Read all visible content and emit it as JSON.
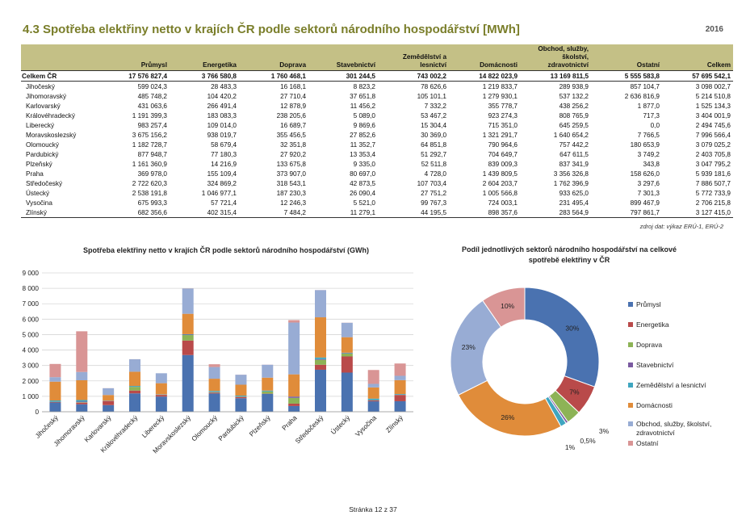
{
  "header": {
    "title": "4.3  Spotřeba elektřiny netto v krajích ČR podle sektorů národního hospodářství [MWh]",
    "year": "2016"
  },
  "table": {
    "columns": [
      "",
      "Průmysl",
      "Energetika",
      "Doprava",
      "Stavebnictví",
      "Zemědělství a lesnictví",
      "Domácnosti",
      "Obchod, služby, školství, zdravotnictví",
      "Ostatní",
      "Celkem"
    ],
    "total": [
      "Celkem ČR",
      "17 576 827,4",
      "3 766 580,8",
      "1 760 468,1",
      "301 244,5",
      "743 002,2",
      "14 822 023,9",
      "13 169 811,5",
      "5 555 583,8",
      "57 695 542,1"
    ],
    "rows": [
      [
        "Jihočeský",
        "599 024,3",
        "28 483,3",
        "16 168,1",
        "8 823,2",
        "78 626,6",
        "1 219 833,7",
        "289 938,9",
        "857 104,7",
        "3 098 002,7"
      ],
      [
        "Jihomoravský",
        "485 748,2",
        "104 420,2",
        "27 710,4",
        "37 651,8",
        "105 101,1",
        "1 279 930,1",
        "537 132,2",
        "2 636 816,9",
        "5 214 510,8"
      ],
      [
        "Karlovarský",
        "431 063,6",
        "266 491,4",
        "12 878,9",
        "11 456,2",
        "7 332,2",
        "355 778,7",
        "438 256,2",
        "1 877,0",
        "1 525 134,3"
      ],
      [
        "Královéhradecký",
        "1 191 399,3",
        "183 083,3",
        "238 205,6",
        "5 089,0",
        "53 467,2",
        "923 274,3",
        "808 765,9",
        "717,3",
        "3 404 001,9"
      ],
      [
        "Liberecký",
        "983 257,4",
        "109 014,0",
        "16 689,7",
        "9 869,6",
        "15 304,4",
        "715 351,0",
        "645 259,5",
        "0,0",
        "2 494 745,6"
      ],
      [
        "Moravskoslezský",
        "3 675 156,2",
        "938 019,7",
        "355 456,5",
        "27 852,6",
        "30 369,0",
        "1 321 291,7",
        "1 640 654,2",
        "7 766,5",
        "7 996 566,4"
      ],
      [
        "Olomoucký",
        "1 182 728,7",
        "58 679,4",
        "32 351,8",
        "11 352,7",
        "64 851,8",
        "790 964,6",
        "757 442,2",
        "180 653,9",
        "3 079 025,2"
      ],
      [
        "Pardubický",
        "877 948,7",
        "77 180,3",
        "27 920,2",
        "13 353,4",
        "51 292,7",
        "704 649,7",
        "647 611,5",
        "3 749,2",
        "2 403 705,8"
      ],
      [
        "Plzeňský",
        "1 161 360,9",
        "14 216,9",
        "133 675,8",
        "9 335,0",
        "52 511,8",
        "839 009,3",
        "837 341,9",
        "343,8",
        "3 047 795,2"
      ],
      [
        "Praha",
        "369 978,0",
        "155 109,4",
        "373 907,0",
        "80 697,0",
        "4 728,0",
        "1 439 809,5",
        "3 356 326,8",
        "158 626,0",
        "5 939 181,6"
      ],
      [
        "Středočeský",
        "2 722 620,3",
        "324 869,2",
        "318 543,1",
        "42 873,5",
        "107 703,4",
        "2 604 203,7",
        "1 762 396,9",
        "3 297,6",
        "7 886 507,7"
      ],
      [
        "Ústecký",
        "2 538 191,8",
        "1 046 977,1",
        "187 230,3",
        "26 090,4",
        "27 751,2",
        "1 005 566,8",
        "933 625,0",
        "7 301,3",
        "5 772 733,9"
      ],
      [
        "Vysočina",
        "675 993,3",
        "57 721,4",
        "12 246,3",
        "5 521,0",
        "99 767,3",
        "724 003,1",
        "231 495,4",
        "899 467,9",
        "2 706 215,8"
      ],
      [
        "Zlínský",
        "682 356,6",
        "402 315,4",
        "7 484,2",
        "11 279,1",
        "44 195,5",
        "898 357,6",
        "283 564,9",
        "797 861,7",
        "3 127 415,0"
      ]
    ],
    "source": "zdroj dat: výkaz ERÚ-1, ERÚ-2"
  },
  "chart_data": [
    {
      "type": "bar",
      "stacked": true,
      "title": "Spotřeba elektřiny netto v krajích ČR podle sektorů národního hospodářství (GWh)",
      "categories": [
        "Jihočeský",
        "Jihomoravský",
        "Karlovarský",
        "Královéhradecký",
        "Liberecký",
        "Moravskoslezský",
        "Olomoucký",
        "Pardubický",
        "Plzeňský",
        "Praha",
        "Středočeský",
        "Ústecký",
        "Vysočina",
        "Zlínský"
      ],
      "ylim": [
        0,
        9000
      ],
      "yticks": [
        "0",
        "1 000",
        "2 000",
        "3 000",
        "4 000",
        "5 000",
        "6 000",
        "7 000",
        "8 000",
        "9 000"
      ],
      "grid": true,
      "series": [
        {
          "values": [
            599.0,
            485.7,
            431.1,
            1191.4,
            983.3,
            3675.2,
            1182.7,
            877.9,
            1161.4,
            370.0,
            2722.6,
            2538.2,
            676.0,
            682.4
          ],
          "color": "#4a72b0"
        },
        {
          "values": [
            28.5,
            104.4,
            266.5,
            183.1,
            109.0,
            938.0,
            58.7,
            77.2,
            14.2,
            155.1,
            324.9,
            1047.0,
            57.7,
            402.3
          ],
          "color": "#b94a4a"
        },
        {
          "values": [
            16.2,
            27.7,
            12.9,
            238.2,
            16.7,
            355.5,
            32.4,
            27.9,
            133.7,
            373.9,
            318.5,
            187.2,
            12.2,
            7.5
          ],
          "color": "#8db356"
        },
        {
          "values": [
            8.8,
            37.7,
            11.5,
            5.1,
            9.9,
            27.9,
            11.4,
            13.4,
            9.3,
            80.7,
            42.9,
            26.1,
            5.5,
            11.3
          ],
          "color": "#7a5aa0"
        },
        {
          "values": [
            78.6,
            105.1,
            7.3,
            53.5,
            15.3,
            30.4,
            64.9,
            51.3,
            52.5,
            4.7,
            107.7,
            27.8,
            99.8,
            44.2
          ],
          "color": "#3fa6c0"
        },
        {
          "values": [
            1219.8,
            1279.9,
            355.8,
            923.3,
            715.4,
            1321.3,
            791.0,
            704.6,
            839.0,
            1439.8,
            2604.2,
            1005.6,
            724.0,
            898.4
          ],
          "color": "#e08c3a"
        },
        {
          "values": [
            289.9,
            537.1,
            438.3,
            808.8,
            645.3,
            1640.7,
            757.4,
            647.6,
            837.3,
            3356.3,
            1762.4,
            933.6,
            231.5,
            283.6
          ],
          "color": "#98acd4"
        },
        {
          "values": [
            857.1,
            2636.8,
            1.9,
            0.7,
            0.0,
            7.8,
            180.7,
            3.7,
            0.3,
            158.6,
            3.3,
            7.3,
            899.5,
            797.9
          ],
          "color": "#d99595"
        }
      ]
    },
    {
      "type": "pie",
      "donut": true,
      "title": "Podíl jednotlivých sektorů národního hospodářství na celkové spotřebě elektřiny v ČR",
      "labels": [
        "Průmysl",
        "Energetika",
        "Doprava",
        "Stavebnictví",
        "Zemědělství a lesnictví",
        "Domácnosti",
        "Obchod, služby, školství, zdravotnictví",
        "Ostatní"
      ],
      "values": [
        30.5,
        6.5,
        3.1,
        0.5,
        1.3,
        25.7,
        22.8,
        9.6
      ],
      "data_labels": [
        "30%",
        "7%",
        "3%",
        "0,5%",
        "1%",
        "26%",
        "23%",
        "10%"
      ],
      "colors": [
        "#4a72b0",
        "#b94a4a",
        "#8db356",
        "#7a5aa0",
        "#3fa6c0",
        "#e08c3a",
        "#98acd4",
        "#d99595"
      ],
      "legend_position": "right",
      "legend": [
        "Průmysl",
        "Energetika",
        "Doprava",
        "Stavebnictví",
        "Zemědělství a lesnictví",
        "Domácnosti",
        "Obchod, služby, školství,",
        "zdravotnictví",
        "Ostatní"
      ]
    }
  ],
  "footer": {
    "page": "Stránka 12 z 37"
  }
}
